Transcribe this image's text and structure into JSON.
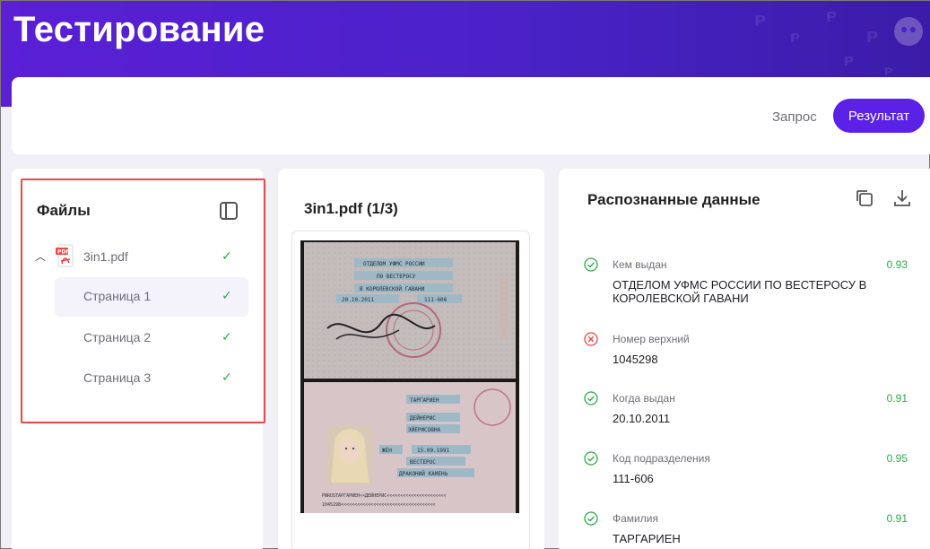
{
  "header": {
    "title": "Тестирование"
  },
  "tabs": {
    "request": "Запрос",
    "result": "Результат"
  },
  "files": {
    "title": "Файлы",
    "file_name": "3in1.pdf",
    "pages": [
      {
        "label": "Страница 1",
        "active": true
      },
      {
        "label": "Страница 2",
        "active": false
      },
      {
        "label": "Страница 3",
        "active": false
      }
    ]
  },
  "preview": {
    "title": "3in1.pdf (1/3)"
  },
  "data": {
    "title": "Распознанные данные",
    "fields": [
      {
        "status": "ok",
        "label": "Кем выдан",
        "score": "0.93",
        "value": "ОТДЕЛОМ УФМС РОССИИ ПО ВЕСТЕРОСУ В КОРОЛЕВСКОЙ ГАВАНИ"
      },
      {
        "status": "error",
        "label": "Номер верхний",
        "score": "",
        "value": "1045298"
      },
      {
        "status": "ok",
        "label": "Когда выдан",
        "score": "0.91",
        "value": "20.10.2011"
      },
      {
        "status": "ok",
        "label": "Код подразделения",
        "score": "0.95",
        "value": "111-606"
      },
      {
        "status": "ok",
        "label": "Фамилия",
        "score": "0.91",
        "value": "ТАРГАРИЕН"
      }
    ]
  },
  "document_image": {
    "issuer_lines": [
      "ОТДЕЛОМ УФМС РОССИИ",
      "ПО ВЕСТЕРОСУ",
      "В КОРОЛЕВСКОЙ ГАВАНИ"
    ],
    "date": "20.10.2011",
    "code": "111-606",
    "surname": "ТАРГАРИЕН",
    "name": "ДЕЙНЕРИС",
    "patronymic": "ЭЙЕРИСОВНА",
    "sex": "ЖЕН",
    "birth_date": "15.09.1991",
    "birth_place_1": "ВЕСТЕРОС",
    "birth_place_2": "ДРАКОНИЙ КАМЕНЬ",
    "mrz_1": "PNRUSТАРГАРИЕН<<ДЕЙНЕРИС<<<<<<<<<<<<<<<<<<<<<<",
    "mrz_2": "1045298<<<<<<<<<<<<<<<<<<<<<<<<<<<<<<<<<<<"
  }
}
